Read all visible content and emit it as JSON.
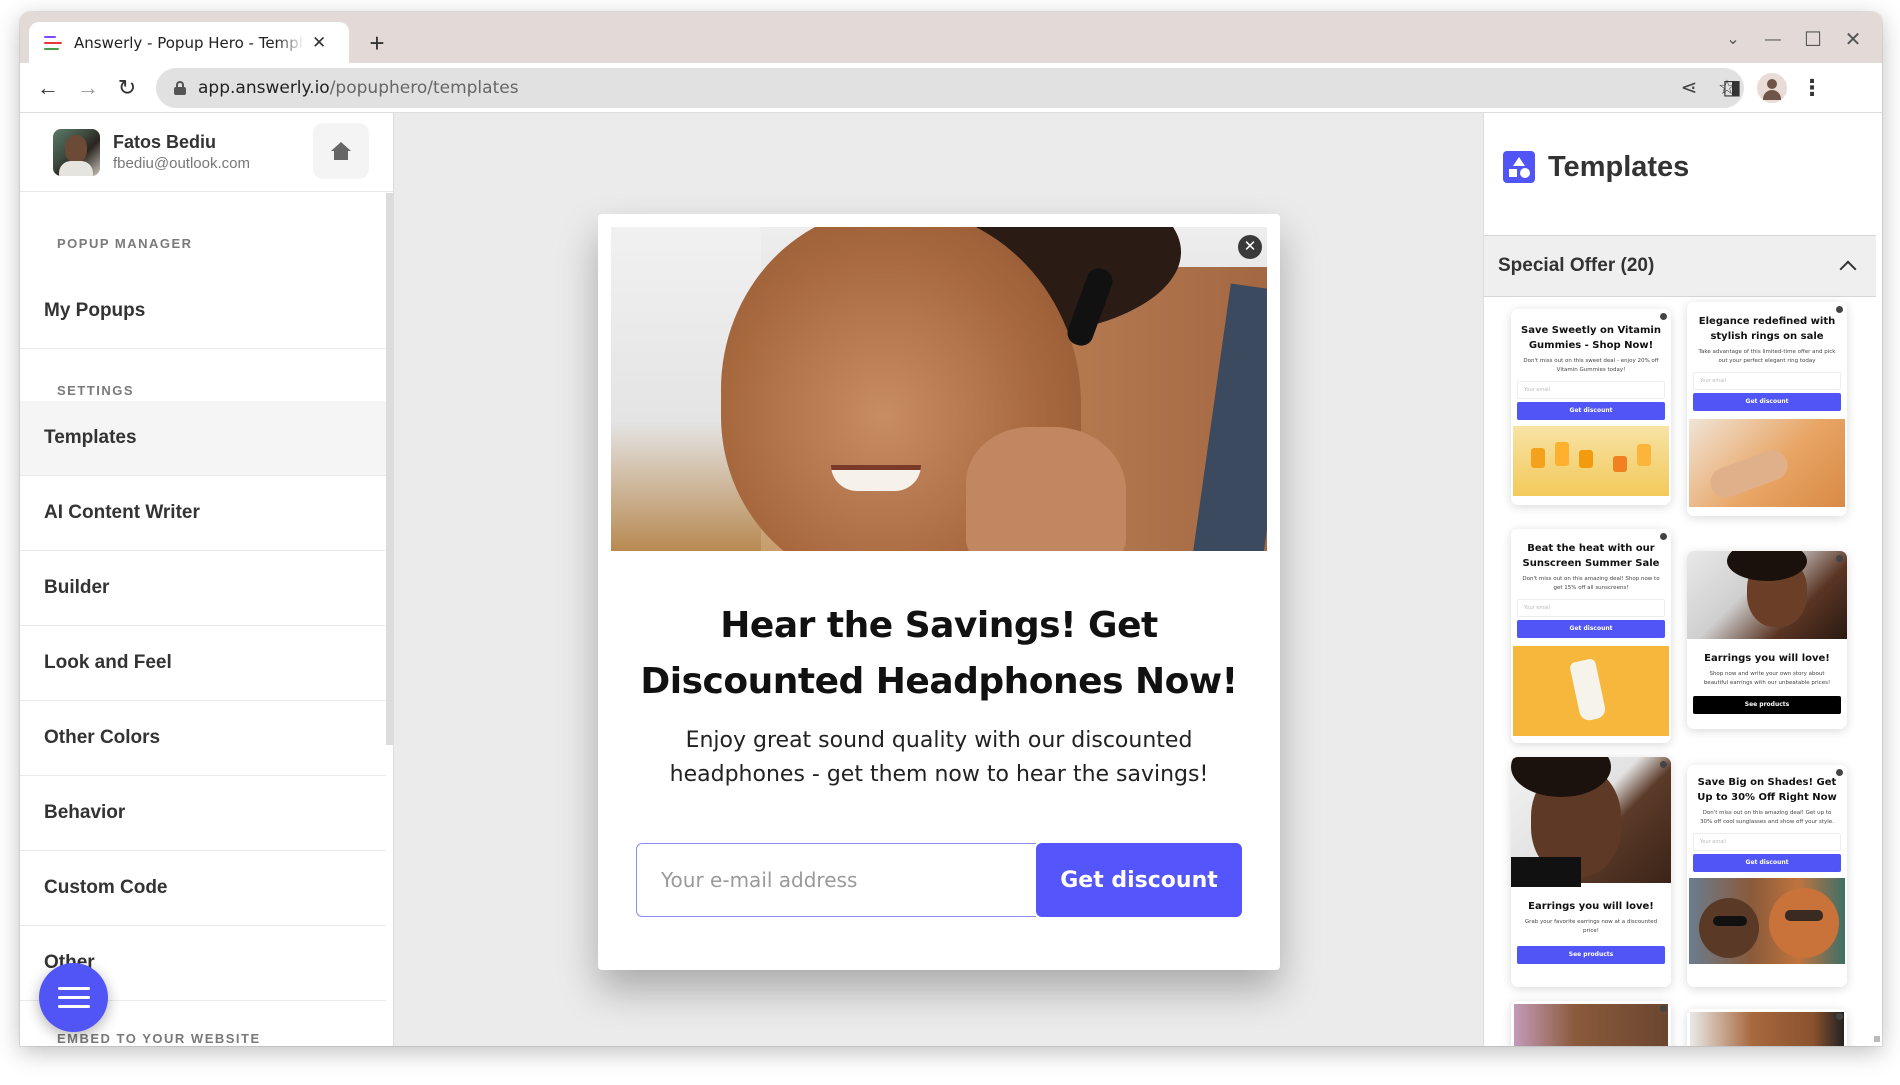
{
  "browser": {
    "tab_title": "Answerly - Popup Hero - Templates",
    "tab_close": "✕",
    "new_tab": "+",
    "url_host": "app.answerly.io",
    "url_path": "/popuphero/templates",
    "icons": {
      "back": "←",
      "forward": "→",
      "reload": "↻",
      "share": "⋖",
      "bookmark": "☆",
      "sidepanel": "◨",
      "menu": "⋮",
      "tab_search": "⌄",
      "minimize": "—",
      "maximize": "☐",
      "close": "✕"
    },
    "favicon_colors": [
      "#7c4dff",
      "#e53935",
      "#43a047"
    ]
  },
  "user": {
    "name": "Fatos Bediu",
    "email": "fbediu@outlook.com"
  },
  "sidebar": {
    "sections": [
      {
        "title": "POPUP MANAGER",
        "items": [
          {
            "label": "My Popups",
            "active": false
          }
        ]
      },
      {
        "title": "SETTINGS",
        "items": [
          {
            "label": "Templates",
            "active": true
          },
          {
            "label": "AI Content Writer",
            "active": false
          },
          {
            "label": "Builder",
            "active": false
          },
          {
            "label": "Look and Feel",
            "active": false
          },
          {
            "label": "Other Colors",
            "active": false
          },
          {
            "label": "Behavior",
            "active": false
          },
          {
            "label": "Custom Code",
            "active": false
          },
          {
            "label": "Other",
            "active": false
          }
        ]
      },
      {
        "title": "EMBED TO YOUR WEBSITE",
        "items": []
      }
    ]
  },
  "popup": {
    "close_icon": "✕",
    "title": "Hear the Savings! Get Discounted Headphones Now!",
    "subtitle": "Enjoy great sound quality with our discounted headphones - get them now to hear the savings!",
    "email_placeholder": "Your e-mail address",
    "button_label": "Get discount",
    "accent": "#5455fb"
  },
  "templates_panel": {
    "title": "Templates",
    "section_label": "Special Offer (20)",
    "cards": [
      {
        "title": "Save Sweetly on Vitamin Gummies - Shop Now!",
        "desc": "Don't miss out on this sweet deal - enjoy 20% off Vitamin Gummies today!",
        "input": "Your email",
        "button": "Get discount",
        "button_style": "blue",
        "image": "vitamins"
      },
      {
        "title": "Elegance redefined with stylish rings on sale",
        "desc": "Take advantage of this limited-time offer and pick out your perfect elegant ring today",
        "input": "Your email",
        "button": "Get discount",
        "button_style": "blue",
        "image": "rings"
      },
      {
        "title": "Beat the heat with our Sunscreen Summer Sale",
        "desc": "Don't miss out on this amazing deal! Shop now to get 15% off all sunscreens!",
        "input": "Your email",
        "button": "Get discount",
        "button_style": "blue",
        "image": "sunscreen"
      },
      {
        "title": "Earrings you will love!",
        "desc": "Shop now and write your own story about beautiful earrings with our unbeatable prices!",
        "input": "",
        "button": "See products",
        "button_style": "black",
        "image": "earrings-dark"
      },
      {
        "title": "Earrings you will love!",
        "desc": "Grab your favorite earrings now at a discounted price!",
        "input": "",
        "button": "See products",
        "button_style": "blue",
        "image": "earrings-portrait"
      },
      {
        "title": "Save Big on Shades! Get Up to 30% Off Right Now",
        "desc": "Don't miss out on this amazing deal! Get up to 30% off cool sunglasses and show off your style.",
        "input": "Your email",
        "button": "Get discount",
        "button_style": "blue",
        "image": "sunglasses"
      }
    ]
  }
}
